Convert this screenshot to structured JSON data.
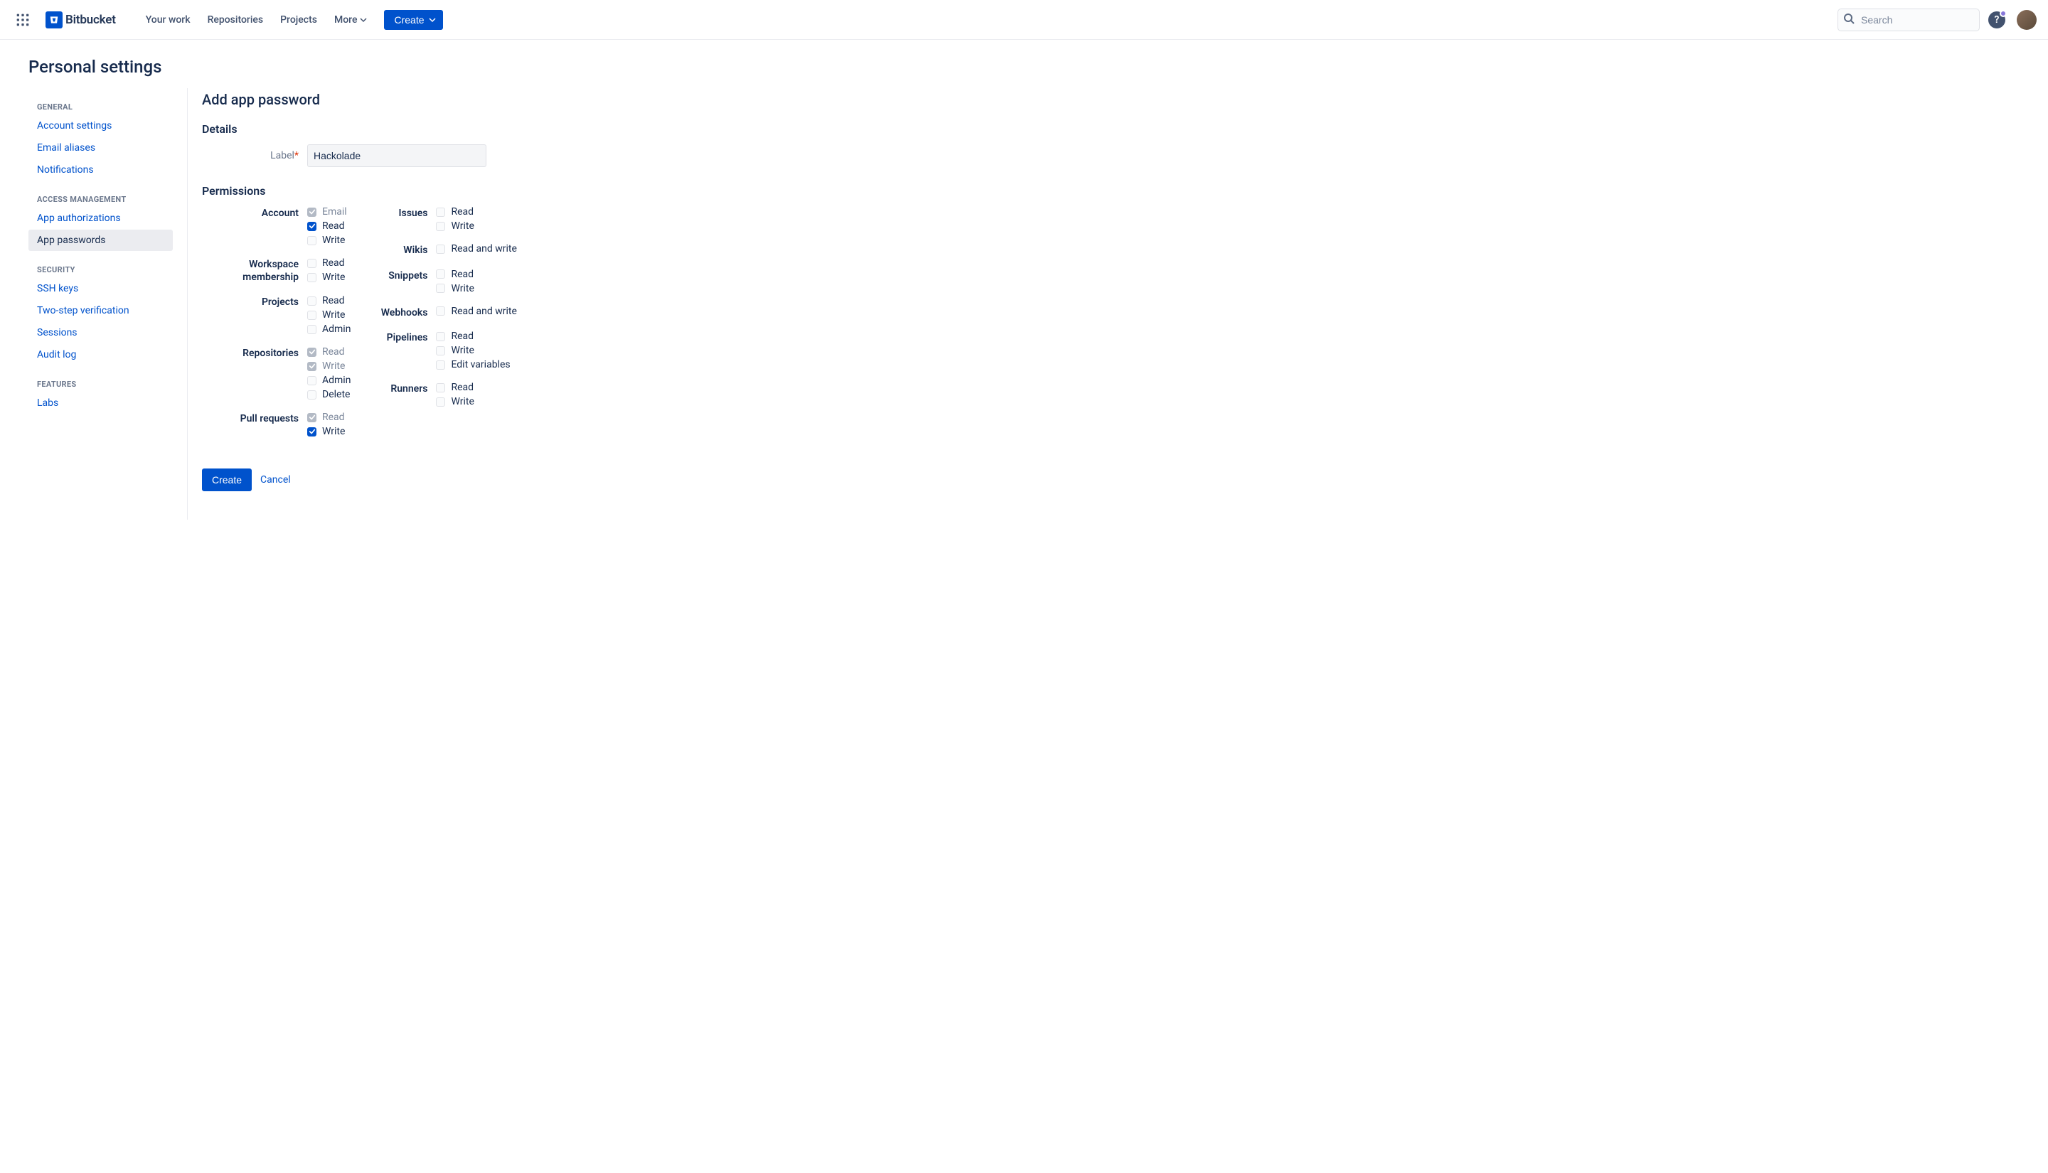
{
  "brand": {
    "name": "Bitbucket"
  },
  "topnav": {
    "items": [
      "Your work",
      "Repositories",
      "Projects",
      "More"
    ],
    "create": "Create",
    "search_placeholder": "Search"
  },
  "page_title": "Personal settings",
  "sidebar": {
    "groups": [
      {
        "title": "GENERAL",
        "items": [
          {
            "label": "Account settings",
            "active": false
          },
          {
            "label": "Email aliases",
            "active": false
          },
          {
            "label": "Notifications",
            "active": false
          }
        ]
      },
      {
        "title": "ACCESS MANAGEMENT",
        "items": [
          {
            "label": "App authorizations",
            "active": false
          },
          {
            "label": "App passwords",
            "active": true
          }
        ]
      },
      {
        "title": "SECURITY",
        "items": [
          {
            "label": "SSH keys",
            "active": false
          },
          {
            "label": "Two-step verification",
            "active": false
          },
          {
            "label": "Sessions",
            "active": false
          },
          {
            "label": "Audit log",
            "active": false
          }
        ]
      },
      {
        "title": "FEATURES",
        "items": [
          {
            "label": "Labs",
            "active": false
          }
        ]
      }
    ]
  },
  "main": {
    "heading": "Add app password",
    "details_title": "Details",
    "label_label": "Label",
    "label_value": "Hackolade",
    "permissions_title": "Permissions",
    "permissions_left": [
      {
        "name": "Account",
        "opts": [
          {
            "label": "Email",
            "checked": true,
            "disabled": true
          },
          {
            "label": "Read",
            "checked": true,
            "disabled": false
          },
          {
            "label": "Write",
            "checked": false,
            "disabled": false
          }
        ]
      },
      {
        "name": "Workspace membership",
        "opts": [
          {
            "label": "Read",
            "checked": false,
            "disabled": false
          },
          {
            "label": "Write",
            "checked": false,
            "disabled": false
          }
        ]
      },
      {
        "name": "Projects",
        "opts": [
          {
            "label": "Read",
            "checked": false,
            "disabled": false
          },
          {
            "label": "Write",
            "checked": false,
            "disabled": false
          },
          {
            "label": "Admin",
            "checked": false,
            "disabled": false
          }
        ]
      },
      {
        "name": "Repositories",
        "opts": [
          {
            "label": "Read",
            "checked": true,
            "disabled": true
          },
          {
            "label": "Write",
            "checked": true,
            "disabled": true
          },
          {
            "label": "Admin",
            "checked": false,
            "disabled": false
          },
          {
            "label": "Delete",
            "checked": false,
            "disabled": false
          }
        ]
      },
      {
        "name": "Pull requests",
        "opts": [
          {
            "label": "Read",
            "checked": true,
            "disabled": true
          },
          {
            "label": "Write",
            "checked": true,
            "disabled": false
          }
        ]
      }
    ],
    "permissions_right": [
      {
        "name": "Issues",
        "opts": [
          {
            "label": "Read",
            "checked": false,
            "disabled": false
          },
          {
            "label": "Write",
            "checked": false,
            "disabled": false
          }
        ]
      },
      {
        "name": "Wikis",
        "opts": [
          {
            "label": "Read and write",
            "checked": false,
            "disabled": false
          }
        ]
      },
      {
        "name": "Snippets",
        "opts": [
          {
            "label": "Read",
            "checked": false,
            "disabled": false
          },
          {
            "label": "Write",
            "checked": false,
            "disabled": false
          }
        ]
      },
      {
        "name": "Webhooks",
        "opts": [
          {
            "label": "Read and write",
            "checked": false,
            "disabled": false
          }
        ]
      },
      {
        "name": "Pipelines",
        "opts": [
          {
            "label": "Read",
            "checked": false,
            "disabled": false
          },
          {
            "label": "Write",
            "checked": false,
            "disabled": false
          },
          {
            "label": "Edit variables",
            "checked": false,
            "disabled": false
          }
        ]
      },
      {
        "name": "Runners",
        "opts": [
          {
            "label": "Read",
            "checked": false,
            "disabled": false
          },
          {
            "label": "Write",
            "checked": false,
            "disabled": false
          }
        ]
      }
    ],
    "create_btn": "Create",
    "cancel_btn": "Cancel"
  }
}
